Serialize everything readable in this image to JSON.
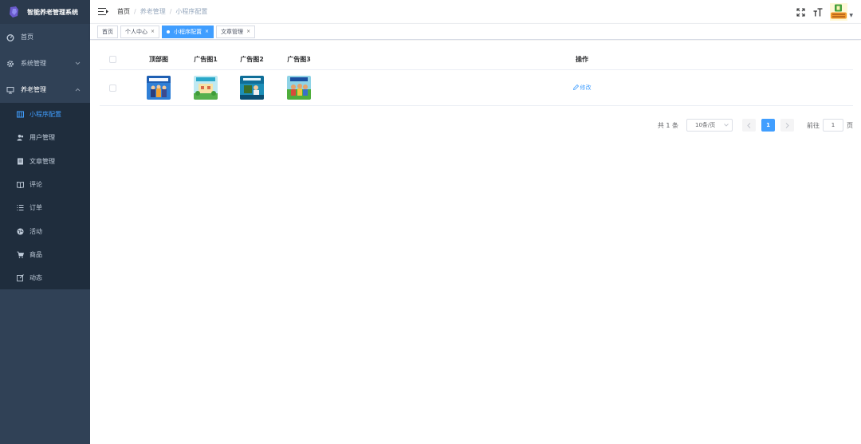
{
  "app": {
    "title": "智能养老管理系统"
  },
  "sidebar": {
    "items": [
      {
        "label": "首页",
        "icon": "dashboard-icon"
      },
      {
        "label": "系统管理",
        "icon": "gear-icon",
        "expanded": false
      },
      {
        "label": "养老管理",
        "icon": "monitor-icon",
        "expanded": true
      }
    ],
    "sub_items": [
      {
        "label": "小程序配置",
        "icon": "grid-icon",
        "active": true
      },
      {
        "label": "用户管理",
        "icon": "user-icon"
      },
      {
        "label": "文章管理",
        "icon": "document-icon"
      },
      {
        "label": "评论",
        "icon": "book-icon"
      },
      {
        "label": "订单",
        "icon": "list-icon"
      },
      {
        "label": "活动",
        "icon": "globe-icon"
      },
      {
        "label": "商品",
        "icon": "cart-icon"
      },
      {
        "label": "动态",
        "icon": "edit-icon"
      }
    ]
  },
  "breadcrumb": [
    "首页",
    "养老管理",
    "小程序配置"
  ],
  "tags": [
    {
      "label": "首页",
      "active": false,
      "closable": false
    },
    {
      "label": "个人中心",
      "active": false,
      "closable": true
    },
    {
      "label": "小程序配置",
      "active": true,
      "closable": true
    },
    {
      "label": "文章管理",
      "active": false,
      "closable": true
    }
  ],
  "table": {
    "columns": [
      "顶部图",
      "广告图1",
      "广告图2",
      "广告图3",
      "操作"
    ],
    "rows": [
      {
        "images": [
          "top-image-thumbnail",
          "ad-image-1-thumbnail",
          "ad-image-2-thumbnail",
          "ad-image-3-thumbnail"
        ],
        "action": "修改"
      }
    ]
  },
  "pagination": {
    "total_text": "共 1 条",
    "page_size": "10条/页",
    "current_page": "1",
    "goto_prefix": "前往",
    "goto_value": "1",
    "goto_suffix": "页"
  },
  "colors": {
    "sidebar_bg": "#304156",
    "accent": "#409eff"
  }
}
